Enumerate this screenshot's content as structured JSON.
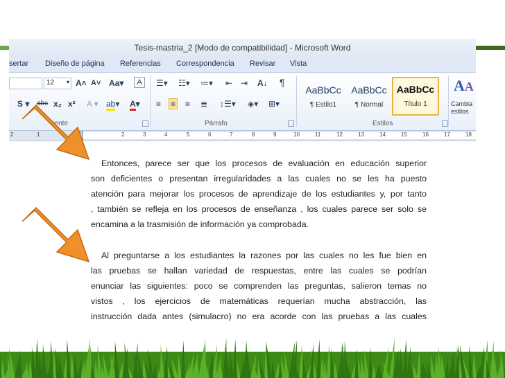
{
  "window": {
    "title": "Tesis-mastria_2 [Modo de compatibilidad] - Microsoft Word"
  },
  "tabs": [
    "sertar",
    "Diseño de página",
    "Referencias",
    "Correspondencia",
    "Revisar",
    "Vista"
  ],
  "font": {
    "size": "12"
  },
  "groups": {
    "font": "uente",
    "paragraph": "Párrafo",
    "styles": "Estilos"
  },
  "styles": [
    {
      "sample": "AaBbCc",
      "name": "¶ Estilo1"
    },
    {
      "sample": "AaBbCc",
      "name": "¶ Normal"
    },
    {
      "sample": "AaBbCc",
      "name": "Título 1"
    }
  ],
  "change_styles": {
    "line1": "Cambia",
    "line2": "estilos"
  },
  "ruler_numbers": [
    "2",
    "1",
    "2",
    "3",
    "4",
    "5",
    "6",
    "7",
    "8",
    "9",
    "10",
    "11",
    "12",
    "13",
    "14",
    "15",
    "16",
    "17",
    "18"
  ],
  "document": {
    "paragraph1": [
      "Entonces, parece ser que los procesos de evaluación en educación superior",
      "son deficientes o presentan irregularidades a las cuales no se les ha puesto",
      "atención para mejorar los procesos de aprendizaje de los estudiantes y, por tanto",
      ", también se refleja en los procesos de enseñanza , los cuales parece ser solo se",
      "encamina a la trasmisión de información ya comprobada."
    ],
    "paragraph2": [
      "Al preguntarse a los estudiantes la razones por las cuales no les fue bien en",
      "las pruebas se hallan variedad de respuestas, entre las cuales se podrían",
      "enunciar las siguientes: poco se comprenden las preguntas, salieron temas no",
      "vistos , los ejercicios de matemáticas requerían mucha abstracción, las",
      "instrucción dada antes (simulacro) no era acorde con las pruebas a las cuales"
    ]
  },
  "colors": {
    "arrow": "#f0902a",
    "arrow_border": "#c06a10",
    "grass": "#4c9a1e",
    "accent_green": "#6aa84f"
  }
}
